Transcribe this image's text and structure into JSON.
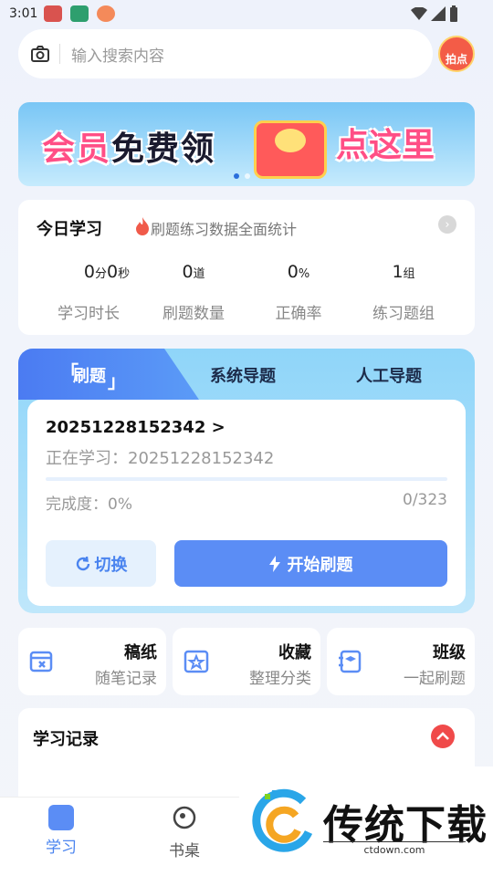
{
  "status_bar": {
    "time": "3:01"
  },
  "search": {
    "placeholder": "输入搜索内容",
    "photo_label": "拍点"
  },
  "banner": {
    "text_left_a": "会员",
    "text_left_b": "免费",
    "text_left_c": "领",
    "text_right": "点这里"
  },
  "today": {
    "title": "今日学习",
    "subtitle": "刷题练习数据全面统计",
    "stats": [
      {
        "v1": "0",
        "u1": "分",
        "v2": "0",
        "u2": "秒",
        "label": "学习时长"
      },
      {
        "v1": "0",
        "u1": "道",
        "label": "刷题数量"
      },
      {
        "v1": "0",
        "u1": "%",
        "label": "正确率"
      },
      {
        "v1": "1",
        "u1": "组",
        "label": "练习题组"
      }
    ]
  },
  "practice": {
    "tabs": [
      "刷题",
      "系统导题",
      "人工导题"
    ],
    "active_tab": 0,
    "set_id": "20251228152342 >",
    "studying": "正在学习：20251228152342",
    "progress_fraction": 0,
    "completion": "完成度：0%",
    "count": "0/323",
    "switch_label": "切换",
    "start_label": "开始刷题"
  },
  "tools": [
    {
      "title": "稿纸",
      "sub": "随笔记录",
      "icon": "draft-icon"
    },
    {
      "title": "收藏",
      "sub": "整理分类",
      "icon": "star-icon"
    },
    {
      "title": "班级",
      "sub": "一起刷题",
      "icon": "class-icon"
    }
  ],
  "record": {
    "title": "学习记录"
  },
  "nav": {
    "items": [
      "学习",
      "书桌"
    ]
  },
  "watermark": {
    "brand": "传统下载",
    "url": "ctdown.com"
  },
  "colors": {
    "accent": "#5b8df5",
    "brand_pink": "#ff4f86",
    "alert": "#f04a4a"
  }
}
